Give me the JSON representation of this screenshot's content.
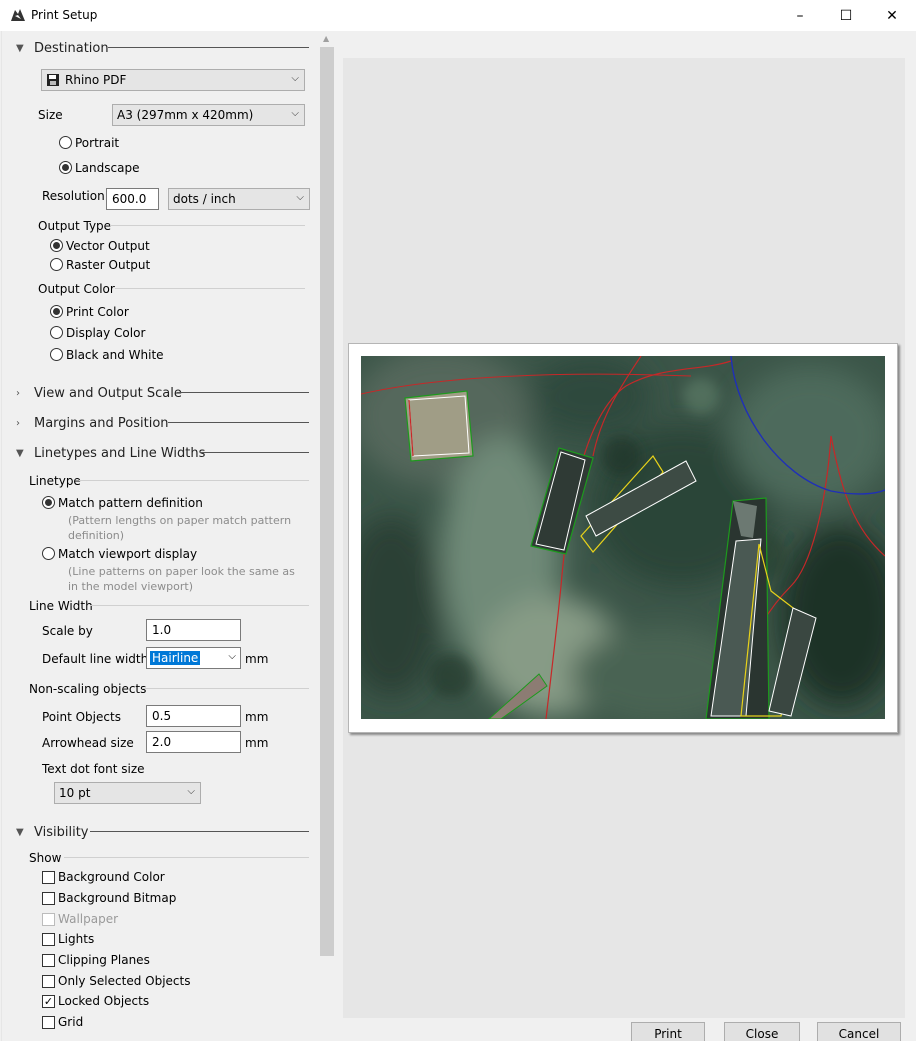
{
  "window": {
    "title": "Print Setup",
    "minimize": "–",
    "maximize": "☐",
    "close": "✕"
  },
  "destination": {
    "header": "Destination",
    "printer": "Rhino PDF",
    "size_label": "Size",
    "size_value": "A3 (297mm x 420mm)",
    "portrait": "Portrait",
    "landscape": "Landscape",
    "resolution_label": "Resolution",
    "resolution_value": "600.0",
    "resolution_unit": "dots / inch",
    "output_type_label": "Output Type",
    "vector_output": "Vector Output",
    "raster_output": "Raster Output",
    "output_color_label": "Output Color",
    "print_color": "Print Color",
    "display_color": "Display Color",
    "black_white": "Black and White"
  },
  "sections": {
    "view_scale": "View and Output Scale",
    "margins": "Margins and Position",
    "linetypes": "Linetypes and Line Widths",
    "visibility": "Visibility"
  },
  "linetypes": {
    "linetype_label": "Linetype",
    "match_pattern": "Match pattern definition",
    "match_pattern_hint_1": "(Pattern lengths on paper match pattern",
    "match_pattern_hint_2": "definition)",
    "match_viewport": "Match viewport display",
    "match_viewport_hint_1": "(Line patterns on paper look the same as",
    "match_viewport_hint_2": "in the model viewport)",
    "line_width_label": "Line Width",
    "scale_by_label": "Scale by",
    "scale_by_value": "1.0",
    "default_width_label": "Default line width",
    "default_width_value": "Hairline",
    "default_width_unit": "mm",
    "non_scaling_label": "Non-scaling objects",
    "point_objects_label": "Point Objects",
    "point_objects_value": "0.5",
    "point_objects_unit": "mm",
    "arrowhead_label": "Arrowhead size",
    "arrowhead_value": "2.0",
    "arrowhead_unit": "mm",
    "text_dot_label": "Text dot font size",
    "text_dot_value": "10 pt"
  },
  "visibility": {
    "show_label": "Show",
    "items": [
      {
        "label": "Background Color",
        "checked": false,
        "disabled": false
      },
      {
        "label": "Background Bitmap",
        "checked": false,
        "disabled": false
      },
      {
        "label": "Wallpaper",
        "checked": false,
        "disabled": true
      },
      {
        "label": "Lights",
        "checked": false,
        "disabled": false
      },
      {
        "label": "Clipping Planes",
        "checked": false,
        "disabled": false
      },
      {
        "label": "Only Selected Objects",
        "checked": false,
        "disabled": false
      },
      {
        "label": "Locked Objects",
        "checked": true,
        "disabled": false
      },
      {
        "label": "Grid",
        "checked": false,
        "disabled": false
      }
    ],
    "check_mark": "✓"
  },
  "footer": {
    "print": "Print",
    "close": "Close",
    "cancel": "Cancel"
  },
  "colors": {
    "accent_selection": "#0078d7",
    "red_curve": "#c62828",
    "blue_arc": "#1f2fb8",
    "yellow_outline": "#e8d21a",
    "green_outline": "#1d9a1d"
  }
}
